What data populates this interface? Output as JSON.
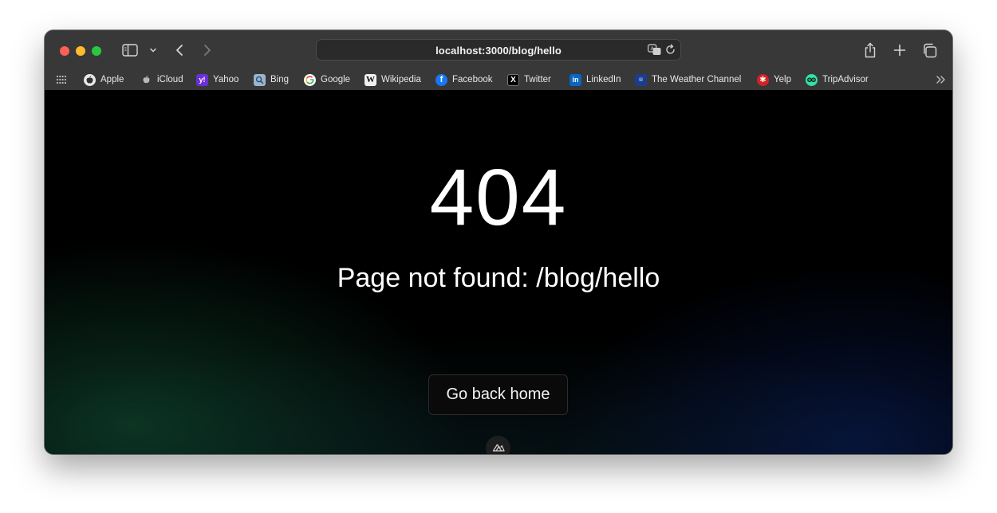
{
  "browser": {
    "url": "localhost:3000/blog/hello",
    "icons": {
      "close": "close-dot",
      "minimize": "minimize-dot",
      "maximize": "maximize-dot",
      "sidebar": "sidebar-icon",
      "tab_overview_menu": "chevron-down-icon",
      "back": "chevron-left-icon",
      "forward": "chevron-right-icon",
      "translate": "translate-icon",
      "reload": "reload-icon",
      "share": "share-icon",
      "new_tab": "plus-icon",
      "tabs": "tabs-icon",
      "apps": "grid-icon",
      "more_bookmarks": "double-chevron-right-icon"
    },
    "colors": {
      "close": "#fe5f57",
      "minimize": "#febc2e",
      "maximize": "#28c840"
    }
  },
  "bookmarks": [
    {
      "label": "Apple",
      "icon": "apple-icon"
    },
    {
      "label": "iCloud",
      "icon": "apple-icon"
    },
    {
      "label": "Yahoo",
      "icon": "yahoo-icon"
    },
    {
      "label": "Bing",
      "icon": "bing-icon"
    },
    {
      "label": "Google",
      "icon": "google-icon"
    },
    {
      "label": "Wikipedia",
      "icon": "wikipedia-icon"
    },
    {
      "label": "Facebook",
      "icon": "facebook-icon"
    },
    {
      "label": "Twitter",
      "icon": "x-icon"
    },
    {
      "label": "LinkedIn",
      "icon": "linkedin-icon"
    },
    {
      "label": "The Weather Channel",
      "icon": "weather-channel-icon"
    },
    {
      "label": "Yelp",
      "icon": "yelp-icon"
    },
    {
      "label": "TripAdvisor",
      "icon": "tripadvisor-icon"
    }
  ],
  "page": {
    "code": "404",
    "message": "Page not found: /blog/hello",
    "home_button": "Go back home",
    "dev_badge_icon": "nuxt-logo-icon"
  }
}
